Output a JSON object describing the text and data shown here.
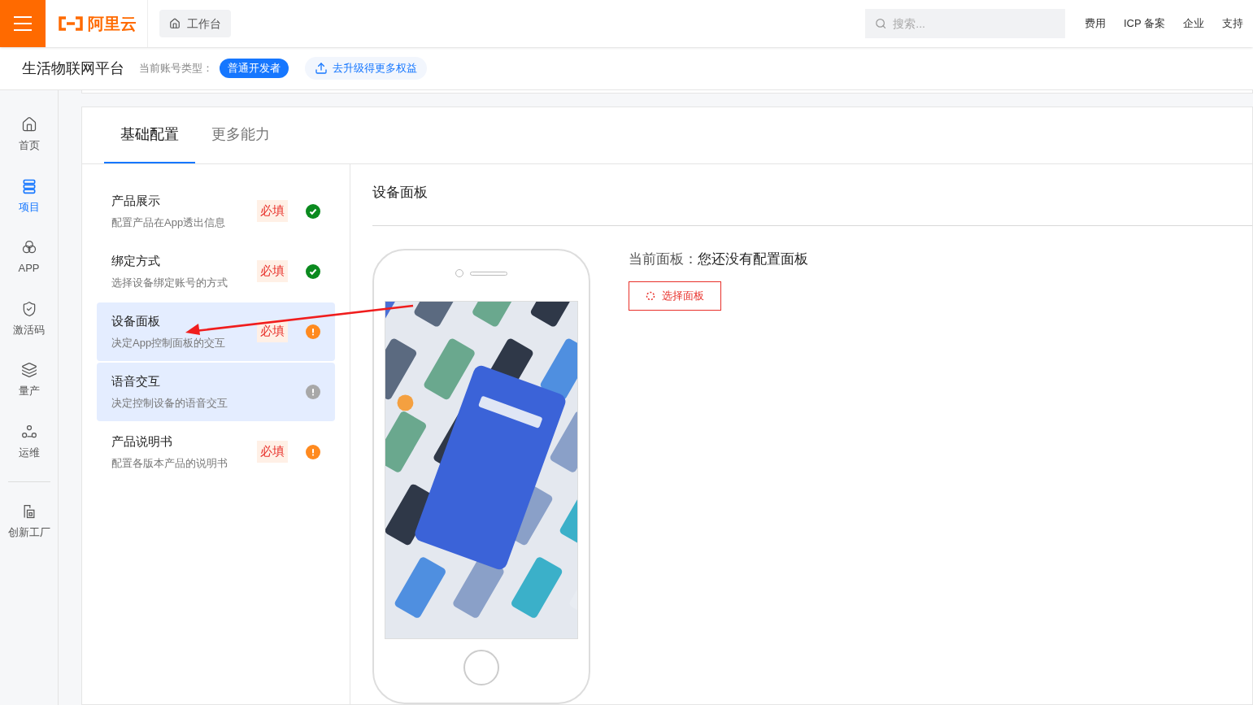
{
  "top_bar": {
    "logo": "阿里云",
    "workbench": "工作台",
    "search": {
      "placeholder": "搜索..."
    },
    "links": [
      "费用",
      "ICP 备案",
      "企业",
      "支持"
    ]
  },
  "sub_header": {
    "title": "生活物联网平台",
    "account_label": "当前账号类型：",
    "account_type": "普通开发者",
    "upgrade": "去升级得更多权益"
  },
  "sidebar": {
    "items": [
      {
        "kind": "home",
        "label": "首页",
        "selected": false
      },
      {
        "kind": "list",
        "label": "项目",
        "selected": true
      },
      {
        "kind": "circles",
        "label": "APP",
        "selected": false
      },
      {
        "kind": "shield",
        "label": "激活码",
        "selected": false
      },
      {
        "kind": "layers",
        "label": "量产",
        "selected": false
      },
      {
        "kind": "nodes",
        "label": "运维",
        "selected": false
      }
    ],
    "bottom_items": [
      {
        "kind": "factory",
        "label": "创新工厂",
        "selected": false
      }
    ]
  },
  "tabs": [
    {
      "label": "基础配置",
      "selected": true
    },
    {
      "label": "更多能力",
      "selected": false
    }
  ],
  "config_items": [
    {
      "title": "产品展示",
      "description": "配置产品在App透出信息",
      "badge": "必填",
      "kind": "done",
      "selected": false
    },
    {
      "title": "绑定方式",
      "description": "选择设备绑定账号的方式",
      "badge": "必填",
      "kind": "done",
      "selected": false
    },
    {
      "title": "设备面板",
      "description": "决定App控制面板的交互",
      "badge": "必填",
      "kind": "todo",
      "selected": true
    },
    {
      "title": "语音交互",
      "description": "决定控制设备的语音交互",
      "kind": "optional",
      "selected": true
    },
    {
      "title": "产品说明书",
      "description": "配置各版本产品的说明书",
      "badge": "必填",
      "kind": "todo",
      "selected": false
    }
  ],
  "panel": {
    "title": "设备面板",
    "current_label": "当前面板：",
    "current_value": "您还没有配置面板",
    "button": "选择面板"
  }
}
